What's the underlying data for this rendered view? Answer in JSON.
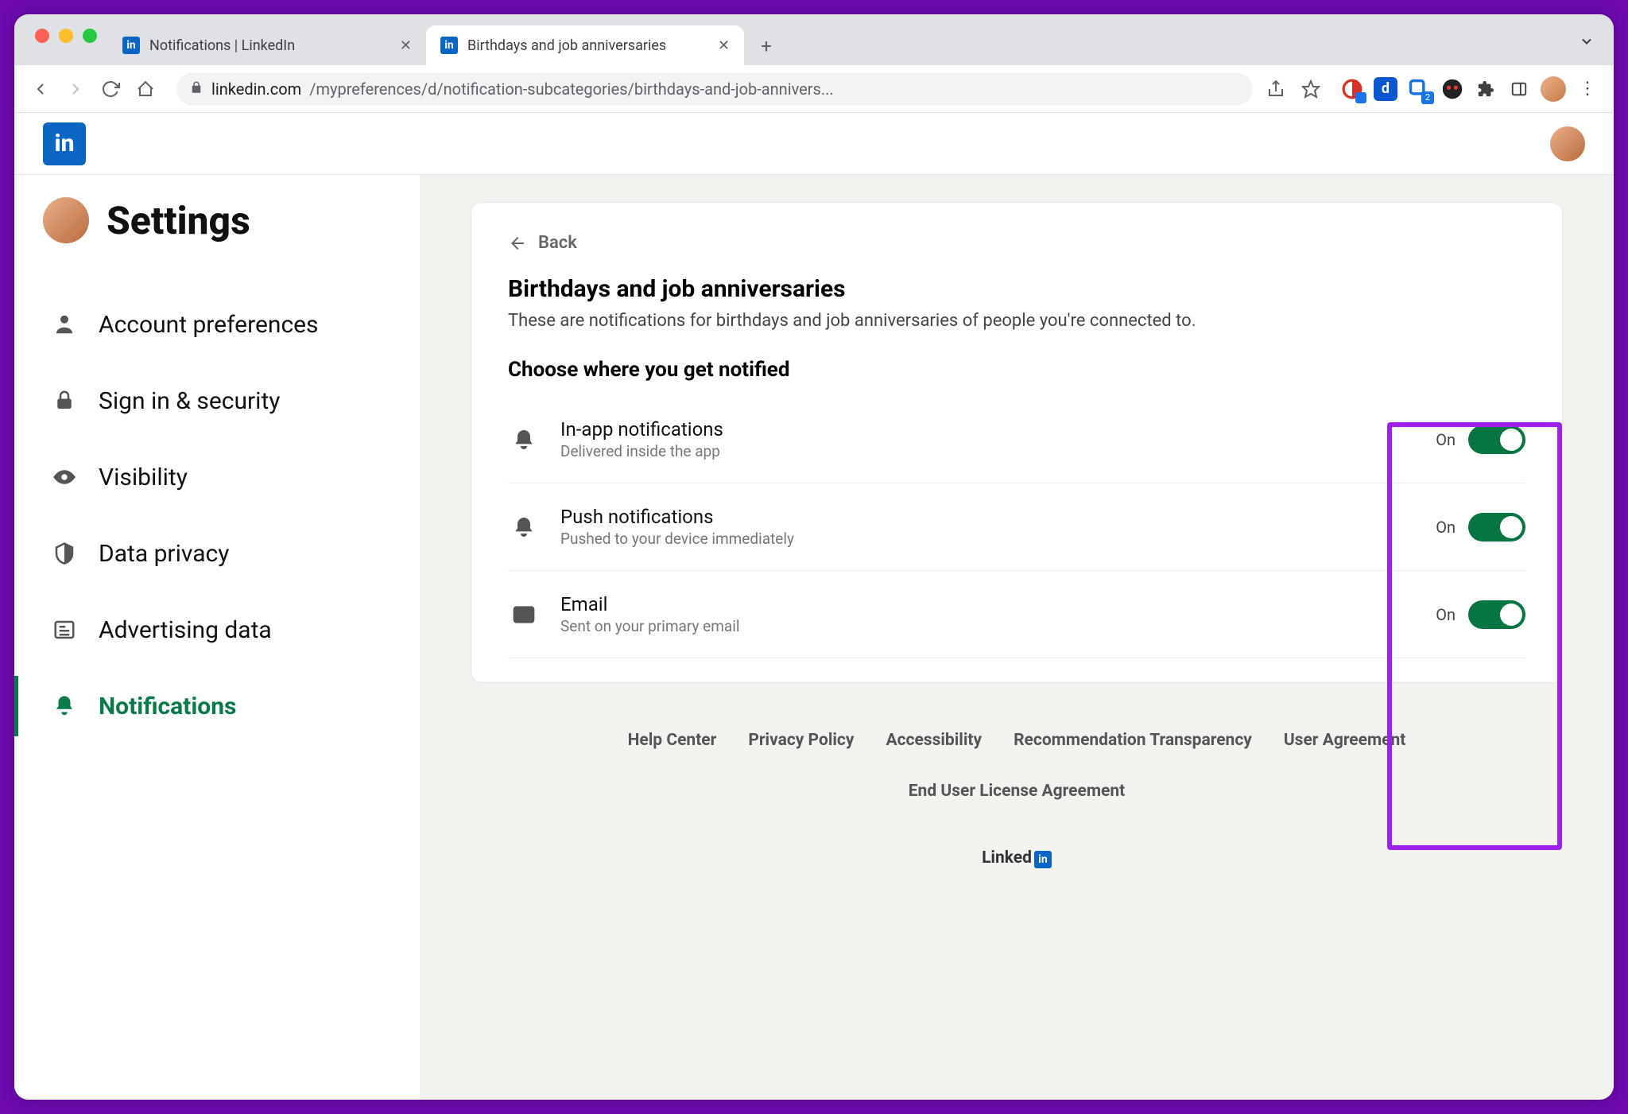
{
  "browser": {
    "tabs": [
      {
        "title": "Notifications | LinkedIn",
        "active": false
      },
      {
        "title": "Birthdays and job anniversaries",
        "active": true
      }
    ],
    "url_host": "linkedin.com",
    "url_path": "/mypreferences/d/notification-subcategories/birthdays-and-job-annivers..."
  },
  "header": {
    "logo_text": "in"
  },
  "sidebar": {
    "title": "Settings",
    "items": [
      {
        "label": "Account preferences",
        "active": false
      },
      {
        "label": "Sign in & security",
        "active": false
      },
      {
        "label": "Visibility",
        "active": false
      },
      {
        "label": "Data privacy",
        "active": false
      },
      {
        "label": "Advertising data",
        "active": false
      },
      {
        "label": "Notifications",
        "active": true
      }
    ]
  },
  "panel": {
    "back_label": "Back",
    "title": "Birthdays and job anniversaries",
    "description": "These are notifications for birthdays and job anniversaries of people you're connected to.",
    "section_heading": "Choose where you get notified",
    "options": [
      {
        "title": "In-app notifications",
        "subtitle": "Delivered inside the app",
        "state": "On",
        "on": true
      },
      {
        "title": "Push notifications",
        "subtitle": "Pushed to your device immediately",
        "state": "On",
        "on": true
      },
      {
        "title": "Email",
        "subtitle": "Sent on your primary email",
        "state": "On",
        "on": true
      }
    ]
  },
  "footer": {
    "links": [
      "Help Center",
      "Privacy Policy",
      "Accessibility",
      "Recommendation Transparency",
      "User Agreement",
      "End User License Agreement"
    ],
    "brand": "Linked"
  },
  "annotation": {
    "highlight": "toggles-column"
  }
}
